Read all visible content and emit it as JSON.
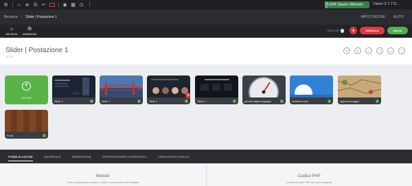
{
  "topbar": {
    "usage_label": "6,69% Spazio Utilizzato",
    "usage_fraction": 0.0669,
    "version": "Vision 3.7.7 D..."
  },
  "breadcrumb": {
    "items": [
      "Bacheca",
      "Slider | Postazione 1"
    ]
  },
  "navlinks": [
    "IMPOSTAZIONI",
    "AIUTO"
  ],
  "toolbar": {
    "dashboard_label": "BACHECA",
    "animation_label": "ANIMAZIONI"
  },
  "actions": {
    "templates_label": "TEMPLATE",
    "cancel_label": "ANNULLA",
    "save_label": "SALVA"
  },
  "page": {
    "title": "Slider | Postazione 1",
    "subtitle": "ID: 75"
  },
  "add_slide": {
    "label": "NUOVA"
  },
  "slides": [
    {
      "caption": "Slide 1",
      "art": "dark-ui"
    },
    {
      "caption": "Slide 1",
      "art": "bridge"
    },
    {
      "caption": "Slide 1",
      "art": "faces"
    },
    {
      "caption": "Slide 1",
      "art": "dark-text"
    },
    {
      "caption": "yoonik-digital-signage",
      "art": "gauge"
    },
    {
      "caption": "medical-room",
      "art": "blue-sky"
    },
    {
      "caption": "agenzia-viaggio",
      "art": "map"
    },
    {
      "caption": "Food",
      "art": "wood"
    }
  ],
  "tabs": [
    {
      "label": "PUBBLICAZIONE",
      "active": true
    },
    {
      "label": "GENERALE",
      "active": false
    },
    {
      "label": "DIMENSIONE",
      "active": false
    },
    {
      "label": "RIPRODUZIONE AUTOMATICA",
      "active": false
    },
    {
      "label": "ANIMAZIONI LIVELLO",
      "active": false
    }
  ],
  "panels": [
    {
      "heading": "Modulo",
      "desc": "Crea un modulo per mostrare lo slider in una posizione del template"
    },
    {
      "heading": "Codice PHP",
      "desc": "Inserisci il codice PHP nel codice sorgente"
    }
  ],
  "colors": {
    "accent_green": "#4caf50",
    "accent_red": "#e0393e",
    "usage_green": "#3c7d4a",
    "add_tile": "#59b348"
  }
}
